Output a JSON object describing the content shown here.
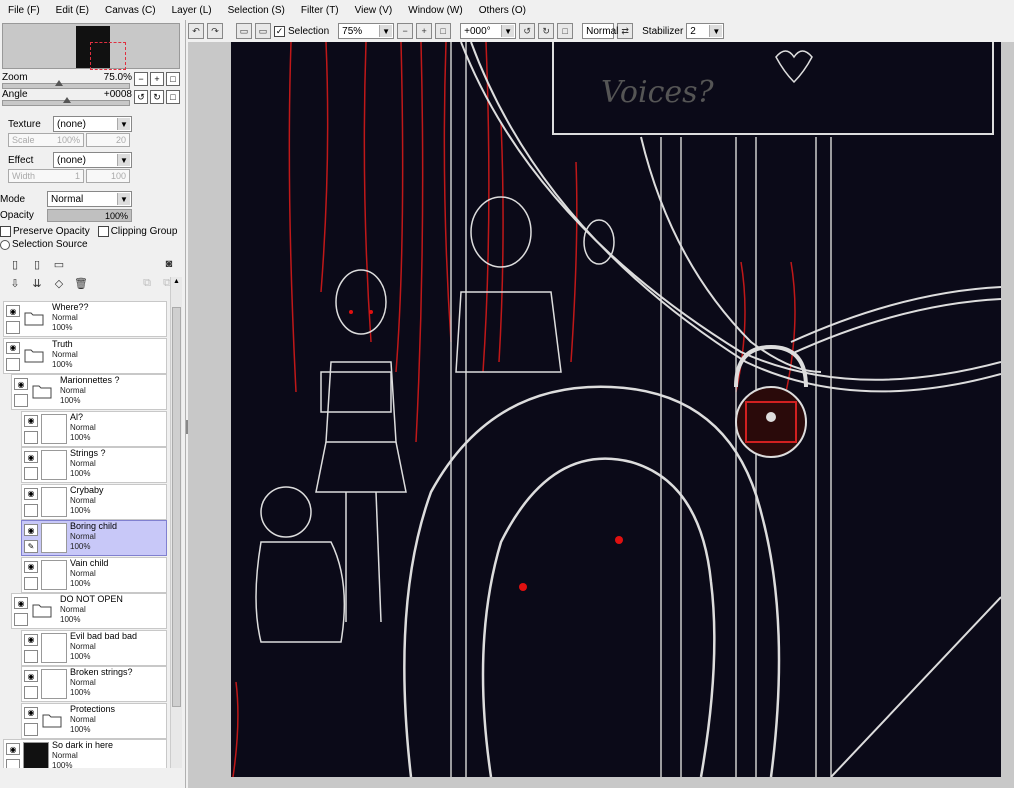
{
  "menu": [
    "File (F)",
    "Edit (E)",
    "Canvas (C)",
    "Layer (L)",
    "Selection (S)",
    "Filter (T)",
    "View (V)",
    "Window (W)",
    "Others (O)"
  ],
  "toolbar": {
    "selection_label": "Selection",
    "zoom_value": "75%",
    "angle_value": "+000°",
    "blend_mode": "Normal",
    "stabilizer_label": "Stabilizer",
    "stabilizer_value": "2"
  },
  "navigator": {
    "zoom_label": "Zoom",
    "zoom_value": "75.0%",
    "angle_label": "Angle",
    "angle_value": "+0008"
  },
  "properties": {
    "texture_label": "Texture",
    "texture_value": "(none)",
    "scale_label": "Scale",
    "scale_value": "100%",
    "scale_num": "20",
    "effect_label": "Effect",
    "effect_value": "(none)",
    "width_label": "Width",
    "width_value": "1",
    "width_num": "100",
    "mode_label": "Mode",
    "mode_value": "Normal",
    "opacity_label": "Opacity",
    "opacity_value": "100%",
    "preserve_opacity": "Preserve Opacity",
    "clipping_group": "Clipping Group",
    "selection_source": "Selection Source"
  },
  "layers": [
    {
      "name": "Where??",
      "mode": "Normal",
      "opacity": "100%",
      "type": "folder",
      "indent": 0
    },
    {
      "name": "Truth",
      "mode": "Normal",
      "opacity": "100%",
      "type": "folder",
      "indent": 0
    },
    {
      "name": "Marionnettes ?",
      "mode": "Normal",
      "opacity": "100%",
      "type": "folder",
      "indent": 1
    },
    {
      "name": "Al?",
      "mode": "Normal",
      "opacity": "100%",
      "type": "layer",
      "indent": 2
    },
    {
      "name": "Strings ?",
      "mode": "Normal",
      "opacity": "100%",
      "type": "layer",
      "indent": 2
    },
    {
      "name": "Crybaby",
      "mode": "Normal",
      "opacity": "100%",
      "type": "layer",
      "indent": 2
    },
    {
      "name": "Boring child",
      "mode": "Normal",
      "opacity": "100%",
      "type": "layer",
      "indent": 2,
      "selected": true
    },
    {
      "name": "Vain child",
      "mode": "Normal",
      "opacity": "100%",
      "type": "layer",
      "indent": 2
    },
    {
      "name": "DO NOT OPEN",
      "mode": "Normal",
      "opacity": "100%",
      "type": "folder",
      "indent": 1
    },
    {
      "name": "Evil bad bad bad",
      "mode": "Normal",
      "opacity": "100%",
      "type": "layer",
      "indent": 2
    },
    {
      "name": "Broken strings?",
      "mode": "Normal",
      "opacity": "100%",
      "type": "layer",
      "indent": 2
    },
    {
      "name": "Protections",
      "mode": "Normal",
      "opacity": "100%",
      "type": "folder",
      "indent": 2
    },
    {
      "name": "So dark in here",
      "mode": "Normal",
      "opacity": "100%",
      "type": "layer",
      "indent": 0
    }
  ],
  "canvas": {
    "text_in_art": "Voices?"
  }
}
